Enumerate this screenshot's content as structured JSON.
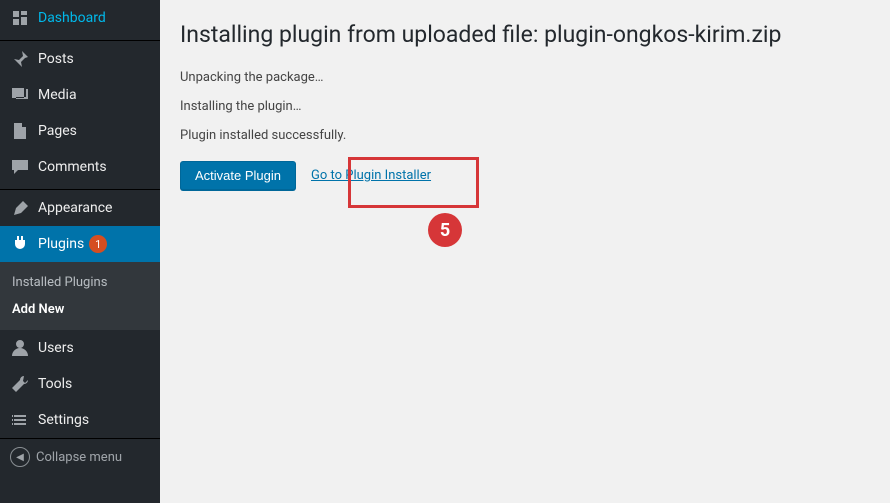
{
  "sidebar": {
    "items": [
      {
        "label": "Dashboard"
      },
      {
        "label": "Posts"
      },
      {
        "label": "Media"
      },
      {
        "label": "Pages"
      },
      {
        "label": "Comments"
      },
      {
        "label": "Appearance"
      },
      {
        "label": "Plugins",
        "badge": "1"
      },
      {
        "label": "Users"
      },
      {
        "label": "Tools"
      },
      {
        "label": "Settings"
      }
    ],
    "submenu": {
      "installed": "Installed Plugins",
      "addnew": "Add New"
    },
    "collapse": "Collapse menu"
  },
  "page": {
    "title": "Installing plugin from uploaded file: plugin-ongkos-kirim.zip",
    "status1": "Unpacking the package…",
    "status2": "Installing the plugin…",
    "status3": "Plugin installed successfully.",
    "activate": "Activate Plugin",
    "go_installer": "Go to Plugin Installer"
  },
  "annotation": {
    "step": "5"
  }
}
